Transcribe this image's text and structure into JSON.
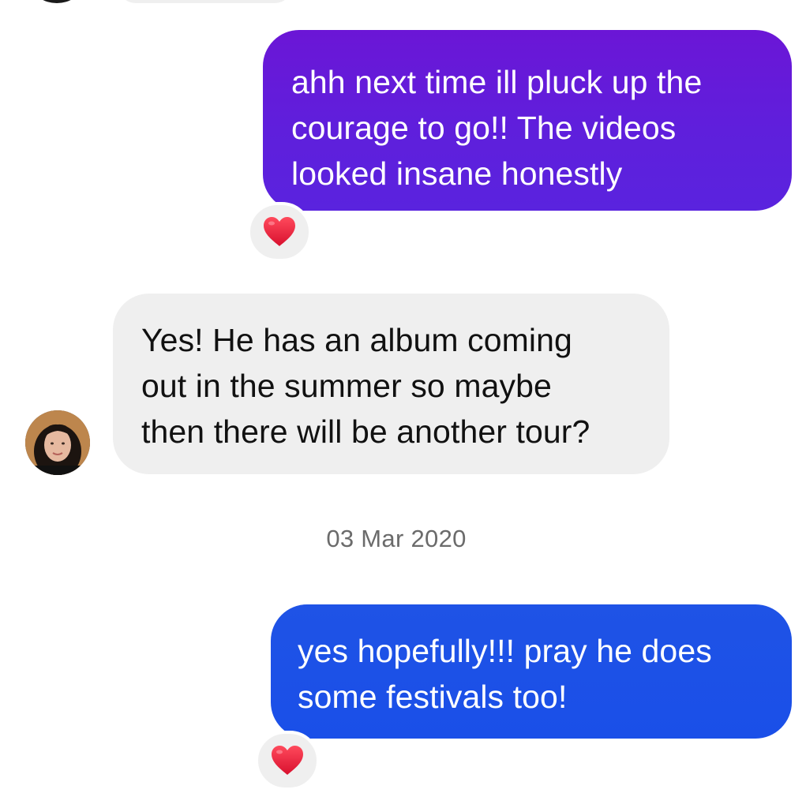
{
  "messages": [
    {
      "direction": "outgoing",
      "text": "ahh next time ill pluck up the\ncourage to go!! The videos\nlooked insane honestly",
      "reaction": "heart-icon",
      "color": "#5f1fdc"
    },
    {
      "direction": "incoming",
      "text": "Yes! He has an album coming\nout in the summer so maybe\nthen there will be another tour?",
      "color": "#efefef"
    },
    {
      "direction": "outgoing",
      "text": "yes hopefully!!! pray he does\nsome festivals too!",
      "reaction": "heart-icon",
      "color": "#1a4fe8"
    }
  ],
  "date_separator": "03 Mar 2020",
  "colors": {
    "outgoing_purple": "#5f1fdc",
    "outgoing_blue": "#1a4fe8",
    "incoming_bubble": "#efefef",
    "timestamp_text": "#6b6b6b",
    "heart": "#e8233f"
  }
}
